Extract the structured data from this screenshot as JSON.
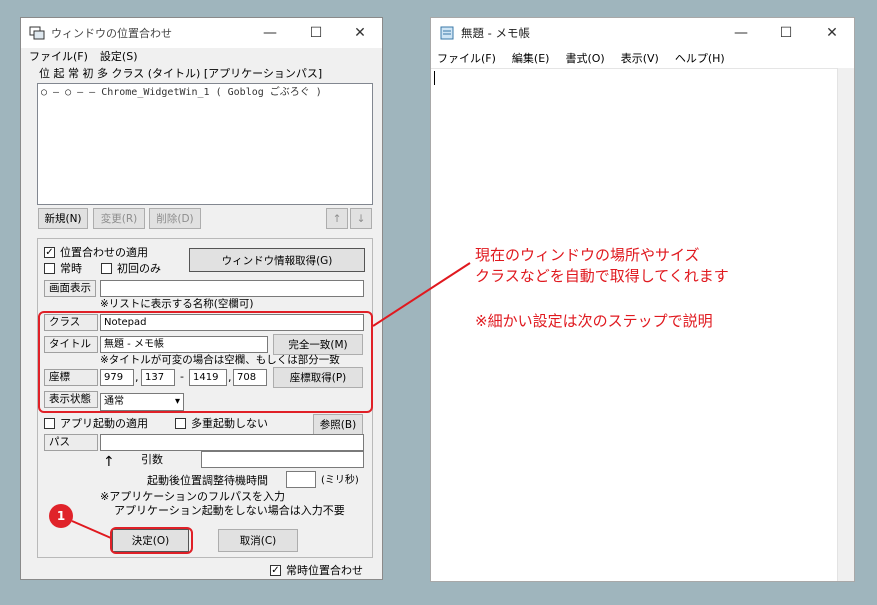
{
  "left_window": {
    "title": "ウィンドウの位置合わせ",
    "controls": {
      "minimize": "—",
      "maximize": "☐",
      "close": "✕"
    },
    "menu": [
      "ファイル(F)",
      "設定(S)"
    ],
    "list_header": "位 起 常 初 多 クラス (タイトル) [アプリケーションパス]",
    "list_items": [
      "○ ― ○ ― ― Chrome_WidgetWin_1 ( Goblog ごぶろぐ )"
    ],
    "list_buttons": {
      "new": "新規(N)",
      "edit": "変更(R)",
      "delete": "削除(D)",
      "up": "↑",
      "down": "↓"
    },
    "apply_position": {
      "label": "位置合わせの適用",
      "checked": true
    },
    "always": {
      "label": "常時",
      "checked": false
    },
    "first_only": {
      "label": "初回のみ",
      "checked": false
    },
    "get_window_info": "ウィンドウ情報取得(G)",
    "display_name": {
      "label": "画面表示",
      "value": "",
      "hint": "※リストに表示する名称(空欄可)"
    },
    "class": {
      "label": "クラス",
      "value": "Notepad"
    },
    "title_field": {
      "label": "タイトル",
      "value": "無題 - メモ帳",
      "exact_match": "完全一致(M)",
      "hint": "※タイトルが可変の場合は空欄、もしくは部分一致"
    },
    "coords": {
      "label": "座標",
      "x1": "979",
      "y1": "137",
      "x2": "1419",
      "y2": "708",
      "sep_comma": ",",
      "sep_dash": "-",
      "get_button": "座標取得(P)"
    },
    "display_state": {
      "label": "表示状態",
      "value": "通常"
    },
    "app_launch": {
      "label": "アプリ起動の適用",
      "checked": false
    },
    "no_multi": {
      "label": "多重起動しない",
      "checked": false
    },
    "browse": "参照(B)",
    "path": {
      "label": "パス",
      "value": ""
    },
    "args_label": "引数",
    "wait_label": "起動後位置調整待機時間",
    "wait_unit": "(ミリ秒)",
    "arrow": "↑",
    "note1": "※アプリケーションのフルパスを入力",
    "note2": "アプリケーション起動をしない場合は入力不要",
    "ok": "決定(O)",
    "cancel": "取消(C)",
    "always_align": {
      "label": "常時位置合わせ",
      "checked": true
    }
  },
  "right_window": {
    "title": "無題 - メモ帳",
    "controls": {
      "minimize": "—",
      "maximize": "☐",
      "close": "✕"
    },
    "menu": [
      "ファイル(F)",
      "編集(E)",
      "書式(O)",
      "表示(V)",
      "ヘルプ(H)"
    ]
  },
  "annotation": {
    "line1": "現在のウィンドウの場所やサイズ",
    "line2": "クラスなどを自動で取得してくれます",
    "line3": "※細かい設定は次のステップで説明",
    "badge": "1",
    "color": "#e0191f"
  }
}
